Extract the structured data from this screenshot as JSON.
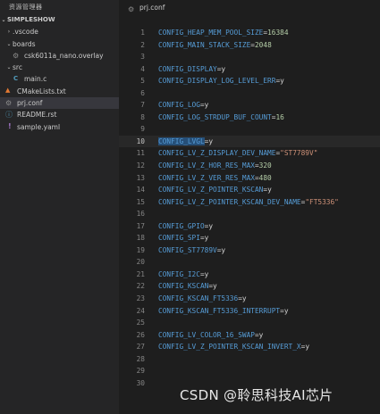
{
  "sidebar": {
    "header": "资源管理器",
    "root": "SIMPLESHOW",
    "items": [
      {
        "label": ".vscode",
        "kind": "folder",
        "expanded": false
      },
      {
        "label": "boards",
        "kind": "folder",
        "expanded": true
      },
      {
        "label": "csk6011a_nano.overlay",
        "kind": "overlay-file"
      },
      {
        "label": "src",
        "kind": "folder",
        "expanded": true
      },
      {
        "label": "main.c",
        "kind": "c-file"
      },
      {
        "label": "CMakeLists.txt",
        "kind": "cmake-file"
      },
      {
        "label": "prj.conf",
        "kind": "conf-file",
        "selected": true
      },
      {
        "label": "README.rst",
        "kind": "info-file"
      },
      {
        "label": "sample.yaml",
        "kind": "yaml-file"
      }
    ]
  },
  "editor": {
    "breadcrumb": "prj.conf",
    "active_line": 10,
    "lines": [
      {
        "n": "1",
        "key": "CONFIG_HEAP_MEM_POOL_SIZE",
        "val": "16384"
      },
      {
        "n": "2",
        "key": "CONFIG_MAIN_STACK_SIZE",
        "val": "2048"
      },
      {
        "n": "3"
      },
      {
        "n": "4",
        "key": "CONFIG_DISPLAY",
        "val": "y"
      },
      {
        "n": "5",
        "key": "CONFIG_DISPLAY_LOG_LEVEL_ERR",
        "val": "y"
      },
      {
        "n": "6"
      },
      {
        "n": "7",
        "key": "CONFIG_LOG",
        "val": "y"
      },
      {
        "n": "8",
        "key": "CONFIG_LOG_STRDUP_BUF_COUNT",
        "val": "16"
      },
      {
        "n": "9"
      },
      {
        "n": "10",
        "key": "CONFIG_LVGL",
        "val": "y",
        "selected_part": "CONFIG_LVGL"
      },
      {
        "n": "11",
        "key": "CONFIG_LV_Z_DISPLAY_DEV_NAME",
        "val": "\"ST7789V\"",
        "string": true
      },
      {
        "n": "12",
        "key": "CONFIG_LV_Z_HOR_RES_MAX",
        "val": "320"
      },
      {
        "n": "13",
        "key": "CONFIG_LV_Z_VER_RES_MAX",
        "val": "480"
      },
      {
        "n": "14",
        "key": "CONFIG_LV_Z_POINTER_KSCAN",
        "val": "y"
      },
      {
        "n": "15",
        "key": "CONFIG_LV_Z_POINTER_KSCAN_DEV_NAME",
        "val": "\"FT5336\"",
        "string": true
      },
      {
        "n": "16"
      },
      {
        "n": "17",
        "key": "CONFIG_GPIO",
        "val": "y"
      },
      {
        "n": "18",
        "key": "CONFIG_SPI",
        "val": "y"
      },
      {
        "n": "19",
        "key": "CONFIG_ST7789V",
        "val": "y"
      },
      {
        "n": "20"
      },
      {
        "n": "21",
        "key": "CONFIG_I2C",
        "val": "y"
      },
      {
        "n": "22",
        "key": "CONFIG_KSCAN",
        "val": "y"
      },
      {
        "n": "23",
        "key": "CONFIG_KSCAN_FT5336",
        "val": "y"
      },
      {
        "n": "24",
        "key": "CONFIG_KSCAN_FT5336_INTERRUPT",
        "val": "y"
      },
      {
        "n": "25"
      },
      {
        "n": "26",
        "key": "CONFIG_LV_COLOR_16_SWAP",
        "val": "y"
      },
      {
        "n": "27",
        "key": "CONFIG_LV_Z_POINTER_KSCAN_INVERT_X",
        "val": "y"
      },
      {
        "n": "28"
      },
      {
        "n": "29"
      },
      {
        "n": "30"
      }
    ]
  },
  "watermark": "CSDN @聆思科技AI芯片",
  "colors": {
    "background": "#1e1e1e",
    "sidebar": "#252526",
    "key": "#569cd6",
    "number": "#b5cea8",
    "string": "#ce9178",
    "selection": "#264f78"
  }
}
